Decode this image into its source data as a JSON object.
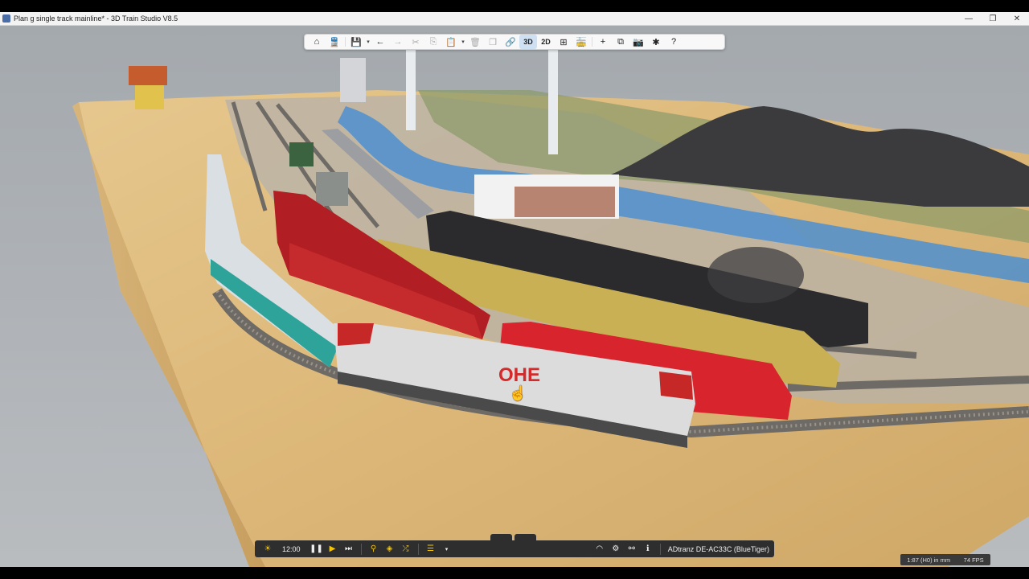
{
  "window": {
    "title": "Plan g single track mainline* - 3D Train Studio V8.5",
    "minimize_glyph": "—",
    "restore_glyph": "❐",
    "close_glyph": "✕"
  },
  "top_toolbar": {
    "view_3d_label": "3D",
    "view_2d_label": "2D",
    "active_view": "3D",
    "icons": [
      "home-icon",
      "train-icon",
      "save-icon",
      "undo-icon",
      "redo-icon",
      "cut-icon",
      "copy-icon",
      "paste-icon",
      "delete-icon",
      "duplicate-icon",
      "link-icon",
      "grid-icon",
      "train-view-icon",
      "add-icon",
      "window-icon",
      "camera-icon",
      "puzzle-icon",
      "help-icon"
    ]
  },
  "bottom_toolbar": {
    "time": "12:00",
    "selected_object": "ADtranz DE-AC33C (BlueTiger)",
    "icons": [
      "sun-icon",
      "pause-icon",
      "play-icon",
      "skip-icon",
      "search-icon",
      "layers-icon",
      "shuffle-icon",
      "list-icon",
      "speedometer-icon",
      "gear-icon",
      "route-icon",
      "info-icon",
      "grid-view-icon",
      "terrain-view-icon"
    ]
  },
  "status": {
    "scale": "1:87 (H0) in mm",
    "fps": "74 FPS"
  },
  "scene": {
    "locomotive_livery": "OHE",
    "accent_colors": {
      "ohe_red": "#d32b2b",
      "red_loco": "#d8242c",
      "yellow_loco": "#c9b055",
      "water": "#4d8fd0"
    }
  }
}
